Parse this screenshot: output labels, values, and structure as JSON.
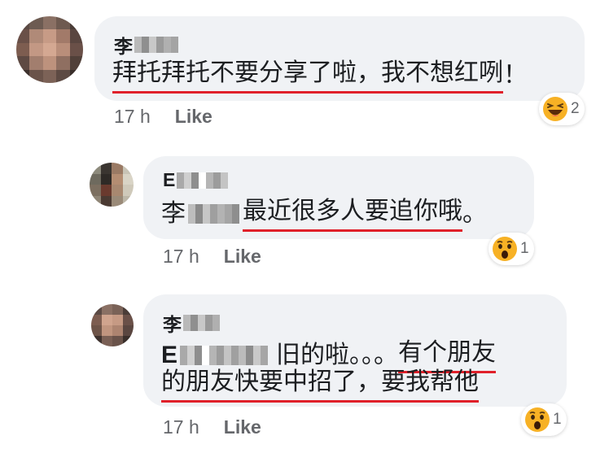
{
  "comments": [
    {
      "name_visible": "李",
      "text_plain": "",
      "text_underlined": "拜托拜托不要分享了啦，我不想红咧",
      "text_after": "！",
      "time": "17 h",
      "like_label": "Like",
      "reaction": {
        "icon": "haha-emoji-icon",
        "count": "2"
      }
    },
    {
      "name_visible": "E",
      "mention_visible": "李",
      "text_underlined": "最近很多人要追你哦",
      "text_after": "。",
      "time": "17 h",
      "like_label": "Like",
      "reaction": {
        "icon": "wow-emoji-icon",
        "count": "1"
      }
    },
    {
      "name_visible": "李",
      "mention_visible": "E",
      "line1_plain": "旧的啦。。。",
      "line1_underlined": "有个朋友",
      "line2_underlined": "的朋友快要中招了，要我帮他",
      "time": "17 h",
      "like_label": "Like",
      "reaction": {
        "icon": "wow-emoji-icon",
        "count": "1"
      }
    }
  ],
  "colors": {
    "bubble": "#f0f2f5",
    "underline": "#e0202a",
    "meta_text": "#65676b",
    "emoji_yellow": "#f7b125"
  }
}
